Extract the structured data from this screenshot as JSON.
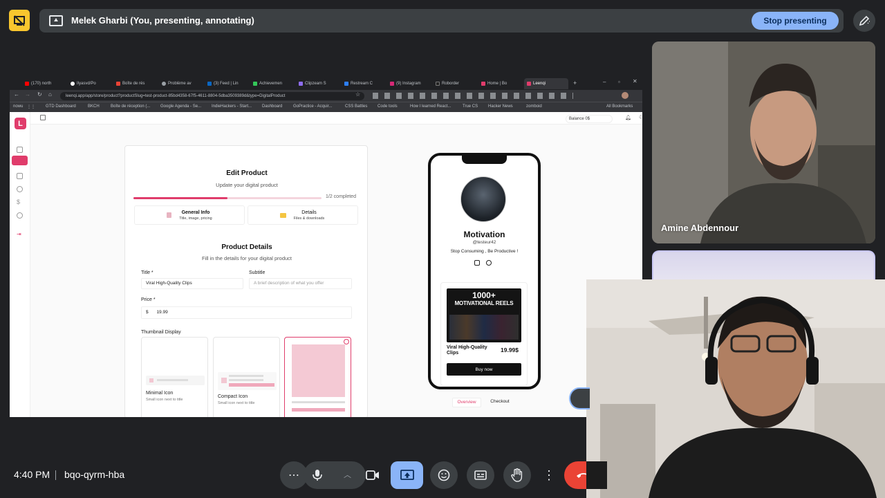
{
  "banner": {
    "presenter_text": "Melek Gharbi (You, presenting, annotating)",
    "stop_label": "Stop presenting"
  },
  "browser": {
    "tabs": [
      "(170) north",
      "Ilyasvd/Po",
      "Boîte de rés",
      "Problème av",
      "(3) Feed | Lin",
      "Achievemen",
      "Clipzeam S",
      "Restream C",
      "(9) Instagram",
      "Roborder",
      "Home | Bo",
      "Leenqi"
    ],
    "url": "leenqi.app/app/store/product?productSlug=test-product-85bd4358-67f5-4611-8804-5dba3509389d&type=DigitalProduct",
    "bookmarks": [
      "GTD Dashboard",
      "BKCH",
      "Boîte de réception (...",
      "Google Agenda - Se...",
      "IndieHackers - Start...",
      "Dashboard",
      "GoPractice - Acquir...",
      "CSS Battles",
      "Code tools",
      "How I learned React...",
      "True CS",
      "Hacker News",
      "zomboid",
      "All Bookmarks"
    ]
  },
  "app": {
    "logo": "L",
    "balance": "Balance  0$",
    "card": {
      "title": "Edit Product",
      "subtitle": "Update your digital product",
      "progress_label": "1/2 completed",
      "progress": 0.5,
      "steps": [
        {
          "title": "General Info",
          "sub": "Title, image, pricing"
        },
        {
          "title": "Details",
          "sub": "Files & downloads"
        }
      ],
      "section_title": "Product Details",
      "section_sub": "Fill in the details for your digital product",
      "title_label": "Title *",
      "title_value": "Viral High-Quality Clips",
      "subtitle_label": "Subtitle",
      "subtitle_placeholder": "A brief description of what you offer",
      "price_label": "Price *",
      "currency": "$",
      "price_value": "19.99",
      "thumbnail_label": "Thumbnail Display",
      "thumbs": [
        {
          "title": "Minimal Icon",
          "sub": "Small icon next to title"
        },
        {
          "title": "Compact Icon",
          "sub": "Small icon next to title"
        }
      ]
    },
    "preview": {
      "name": "Motivation",
      "handle": "@testeur42",
      "bio": "Stop Consuming , Be Productive !",
      "product_img_line1": "1000+",
      "product_img_line2": "MOTIVATIONAL REELS",
      "product_title": "Viral High-Quality Clips",
      "price": "19.99$",
      "buy": "Buy now",
      "tab_overview": "Overview",
      "tab_checkout": "Checkout"
    }
  },
  "participants": {
    "tile1_name": "Amine Abdennour"
  },
  "bottom": {
    "time": "4:40 PM",
    "meeting_code": "bqo-qyrm-hba"
  },
  "colors": {
    "accent": "#e03c6b",
    "stop_button": "#8ab4f8",
    "logo_tile": "#f9c62e",
    "leave": "#ea4335"
  }
}
